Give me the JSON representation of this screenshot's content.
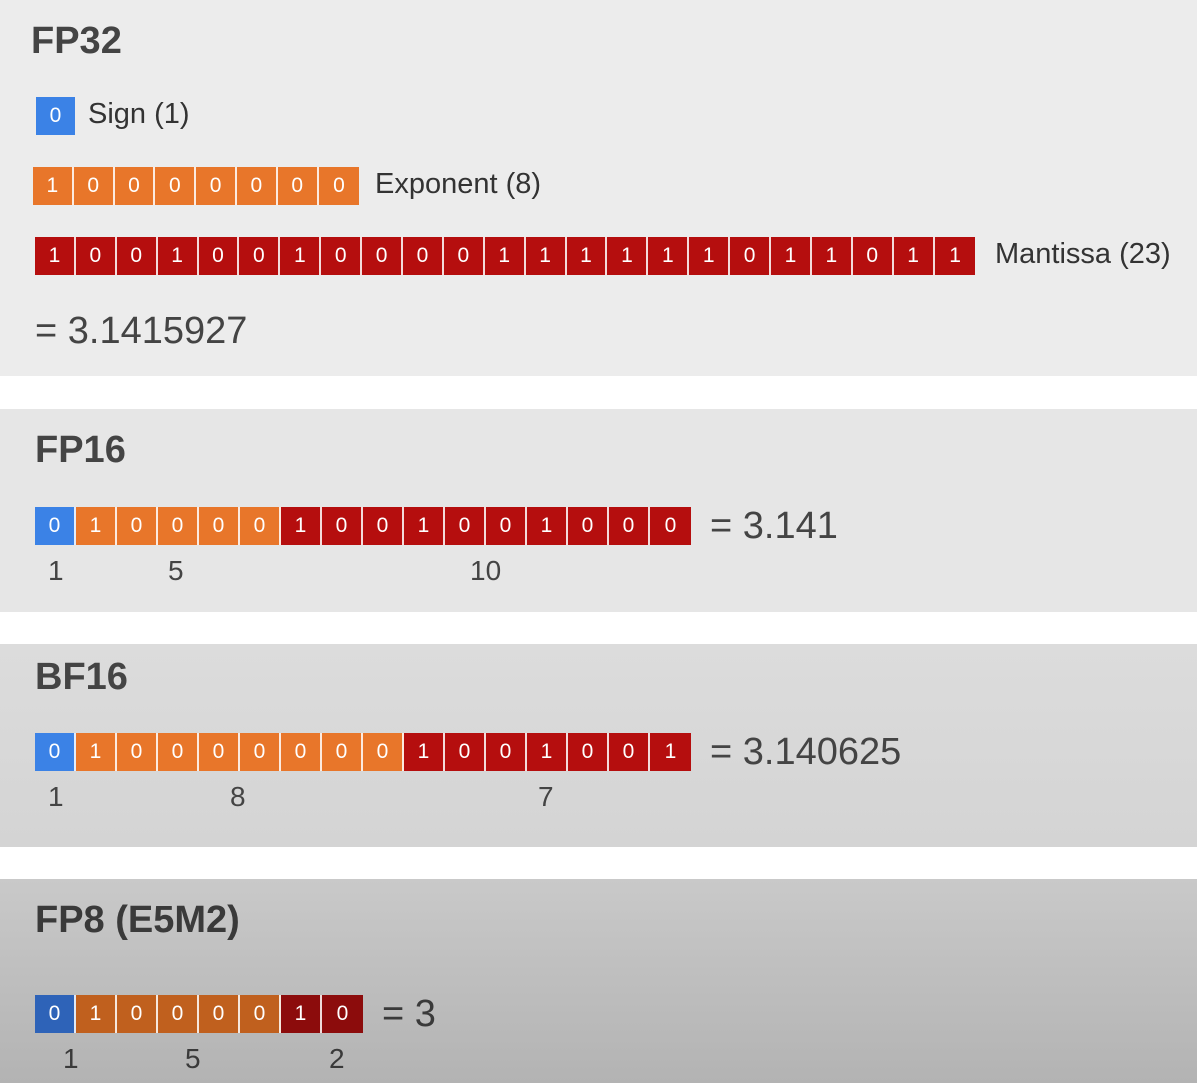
{
  "colors": {
    "sign": "#3b82e6",
    "exponent": "#e8762a",
    "mantissa": "#b50e0e",
    "fp8_sign": "#2e63b8",
    "fp8_exponent": "#c0601e",
    "fp8_mantissa": "#8c0c0c"
  },
  "fp32": {
    "title": "FP32",
    "sign_bits": [
      "0"
    ],
    "sign_label": "Sign (1)",
    "exponent_bits": [
      "1",
      "0",
      "0",
      "0",
      "0",
      "0",
      "0",
      "0"
    ],
    "exponent_label": "Exponent (8)",
    "mantissa_bits": [
      "1",
      "0",
      "0",
      "1",
      "0",
      "0",
      "1",
      "0",
      "0",
      "0",
      "0",
      "1",
      "1",
      "1",
      "1",
      "1",
      "1",
      "0",
      "1",
      "1",
      "0",
      "1",
      "1"
    ],
    "mantissa_label": "Mantissa (23)",
    "value": "= 3.1415927"
  },
  "fp16": {
    "title": "FP16",
    "sign_bits": [
      "0"
    ],
    "exponent_bits": [
      "1",
      "0",
      "0",
      "0",
      "0"
    ],
    "mantissa_bits": [
      "1",
      "0",
      "0",
      "1",
      "0",
      "0",
      "1",
      "0",
      "0",
      "0"
    ],
    "value": "= 3.141",
    "counts": [
      "1",
      "5",
      "10"
    ]
  },
  "bf16": {
    "title": "BF16",
    "sign_bits": [
      "0"
    ],
    "exponent_bits": [
      "1",
      "0",
      "0",
      "0",
      "0",
      "0",
      "0",
      "0"
    ],
    "mantissa_bits": [
      "1",
      "0",
      "0",
      "1",
      "0",
      "0",
      "1"
    ],
    "value": "= 3.140625",
    "counts": [
      "1",
      "8",
      "7"
    ]
  },
  "fp8": {
    "title": "FP8 (E5M2)",
    "sign_bits": [
      "0"
    ],
    "exponent_bits": [
      "1",
      "0",
      "0",
      "0",
      "0"
    ],
    "mantissa_bits": [
      "1",
      "0"
    ],
    "value": "= 3",
    "counts": [
      "1",
      "5",
      "2"
    ]
  }
}
